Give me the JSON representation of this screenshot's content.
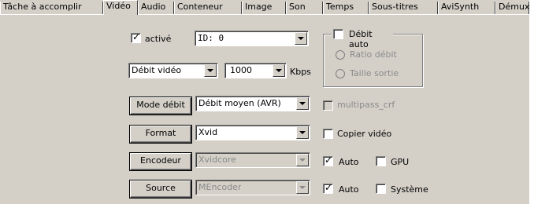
{
  "tabs": [
    {
      "label": "Tâche à accomplir"
    },
    {
      "label": "Vidéo",
      "active": true
    },
    {
      "label": "Audio"
    },
    {
      "label": "Conteneur"
    },
    {
      "label": "Image"
    },
    {
      "label": "Son"
    },
    {
      "label": "Temps"
    },
    {
      "label": "Sous-titres"
    },
    {
      "label": "AviSynth"
    },
    {
      "label": "Démuxer"
    }
  ],
  "video": {
    "active_checkbox": {
      "label": "activé",
      "checked": true
    },
    "id_select": {
      "value": "ID: 0"
    },
    "bitrate_mode_select": {
      "value": "Débit vidéo"
    },
    "bitrate_select": {
      "value": "1000"
    },
    "bitrate_unit": "Kbps"
  },
  "auto_bitrate_group": {
    "checkbox": {
      "label": "Débit auto",
      "checked": false
    },
    "ratio_radio": {
      "label": "Ratio débit",
      "enabled": false
    },
    "size_radio": {
      "label": "Taille sortie",
      "enabled": false
    }
  },
  "rows": {
    "mode": {
      "button": "Mode débit",
      "value": "Débit moyen (AVR)",
      "checkbox_label": "multipass_crf",
      "checkbox_enabled": false
    },
    "format": {
      "button": "Format",
      "value": "Xvid",
      "checkbox_label": "Copier vidéo"
    },
    "encoder": {
      "button": "Encodeur",
      "value": "Xvidcore",
      "auto_label": "Auto",
      "auto_checked": true,
      "gpu_label": "GPU",
      "gpu_checked": false
    },
    "source": {
      "button": "Source",
      "value": "MEncoder",
      "auto_label": "Auto",
      "auto_checked": true,
      "system_label": "Système",
      "system_checked": false
    }
  },
  "colors": {
    "panel": "#d4d0c8",
    "disabled_text": "#8a8a8a"
  }
}
